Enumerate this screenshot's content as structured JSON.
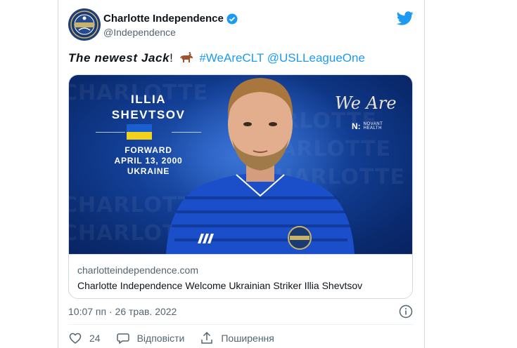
{
  "account": {
    "display_name": "Charlotte Independence",
    "handle": "@Independence",
    "verified": true,
    "avatar_icon": "charlotte-independence-crest-icon"
  },
  "tweet": {
    "text_newest": "The newest Jack",
    "text_exclaim": "!",
    "emoji_icon": "horse-emoji-icon",
    "hashtag": "#WeAreCLT",
    "mention": "@USLLeagueOne"
  },
  "media": {
    "player_first": "ILLIA",
    "player_last": "SHEVTSOV",
    "position": "FORWARD",
    "birthdate": "APRIL 13, 2000",
    "country": "UKRAINE",
    "sponsor_slogan": "We Are",
    "sponsor_mark": "N:",
    "sponsor_line1": "NOVANT",
    "sponsor_line2": "HEALTH",
    "background_text": "CHARLOTTE"
  },
  "link": {
    "domain": "charlotteindependence.com",
    "title": "Charlotte Independence Welcome Ukrainian Striker Illia Shevtsov"
  },
  "meta": {
    "timestamp": "10:07 пп · 26 трав. 2022"
  },
  "actions": {
    "likes": "24",
    "reply_label": "Відповісти",
    "share_label": "Поширення"
  },
  "colors": {
    "link_blue": "#1d9bf0",
    "secondary_text": "#536471",
    "media_blue": "#123e94",
    "flag_blue": "#1a5fd0",
    "flag_yellow": "#f2d21b"
  }
}
